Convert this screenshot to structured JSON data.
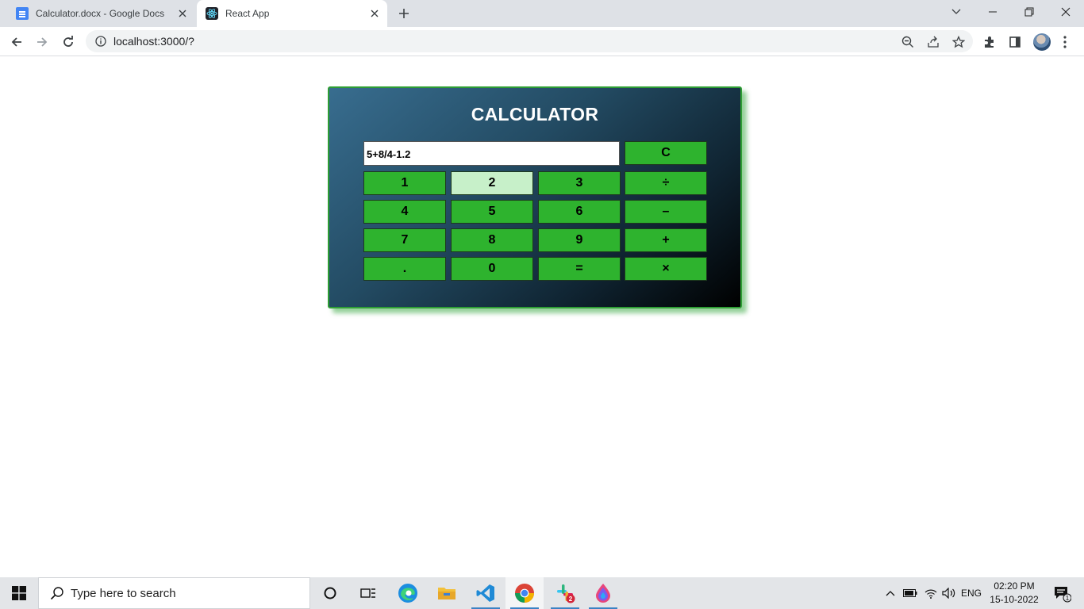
{
  "browser": {
    "tabs": [
      {
        "title": "Calculator.docx - Google Docs",
        "icon": "google-docs-icon"
      },
      {
        "title": "React App",
        "icon": "react-icon"
      }
    ],
    "url": "localhost:3000/?"
  },
  "calculator": {
    "title": "CALCULATOR",
    "display_value": "5+8/4-1.2",
    "clear_label": "C",
    "keys": [
      "1",
      "2",
      "3",
      "÷",
      "4",
      "5",
      "6",
      "–",
      "7",
      "8",
      "9",
      "+",
      ".",
      "0",
      "=",
      "×"
    ],
    "hovered_key": "2",
    "colors": {
      "key_bg": "#2eb32e",
      "key_hover_bg": "#c7f0c9",
      "border": "#2e9e34"
    }
  },
  "taskbar": {
    "search_placeholder": "Type here to search",
    "language": "ENG",
    "time": "02:20 PM",
    "date": "15-10-2022",
    "slack_badge": "2",
    "notification_count": "1"
  }
}
